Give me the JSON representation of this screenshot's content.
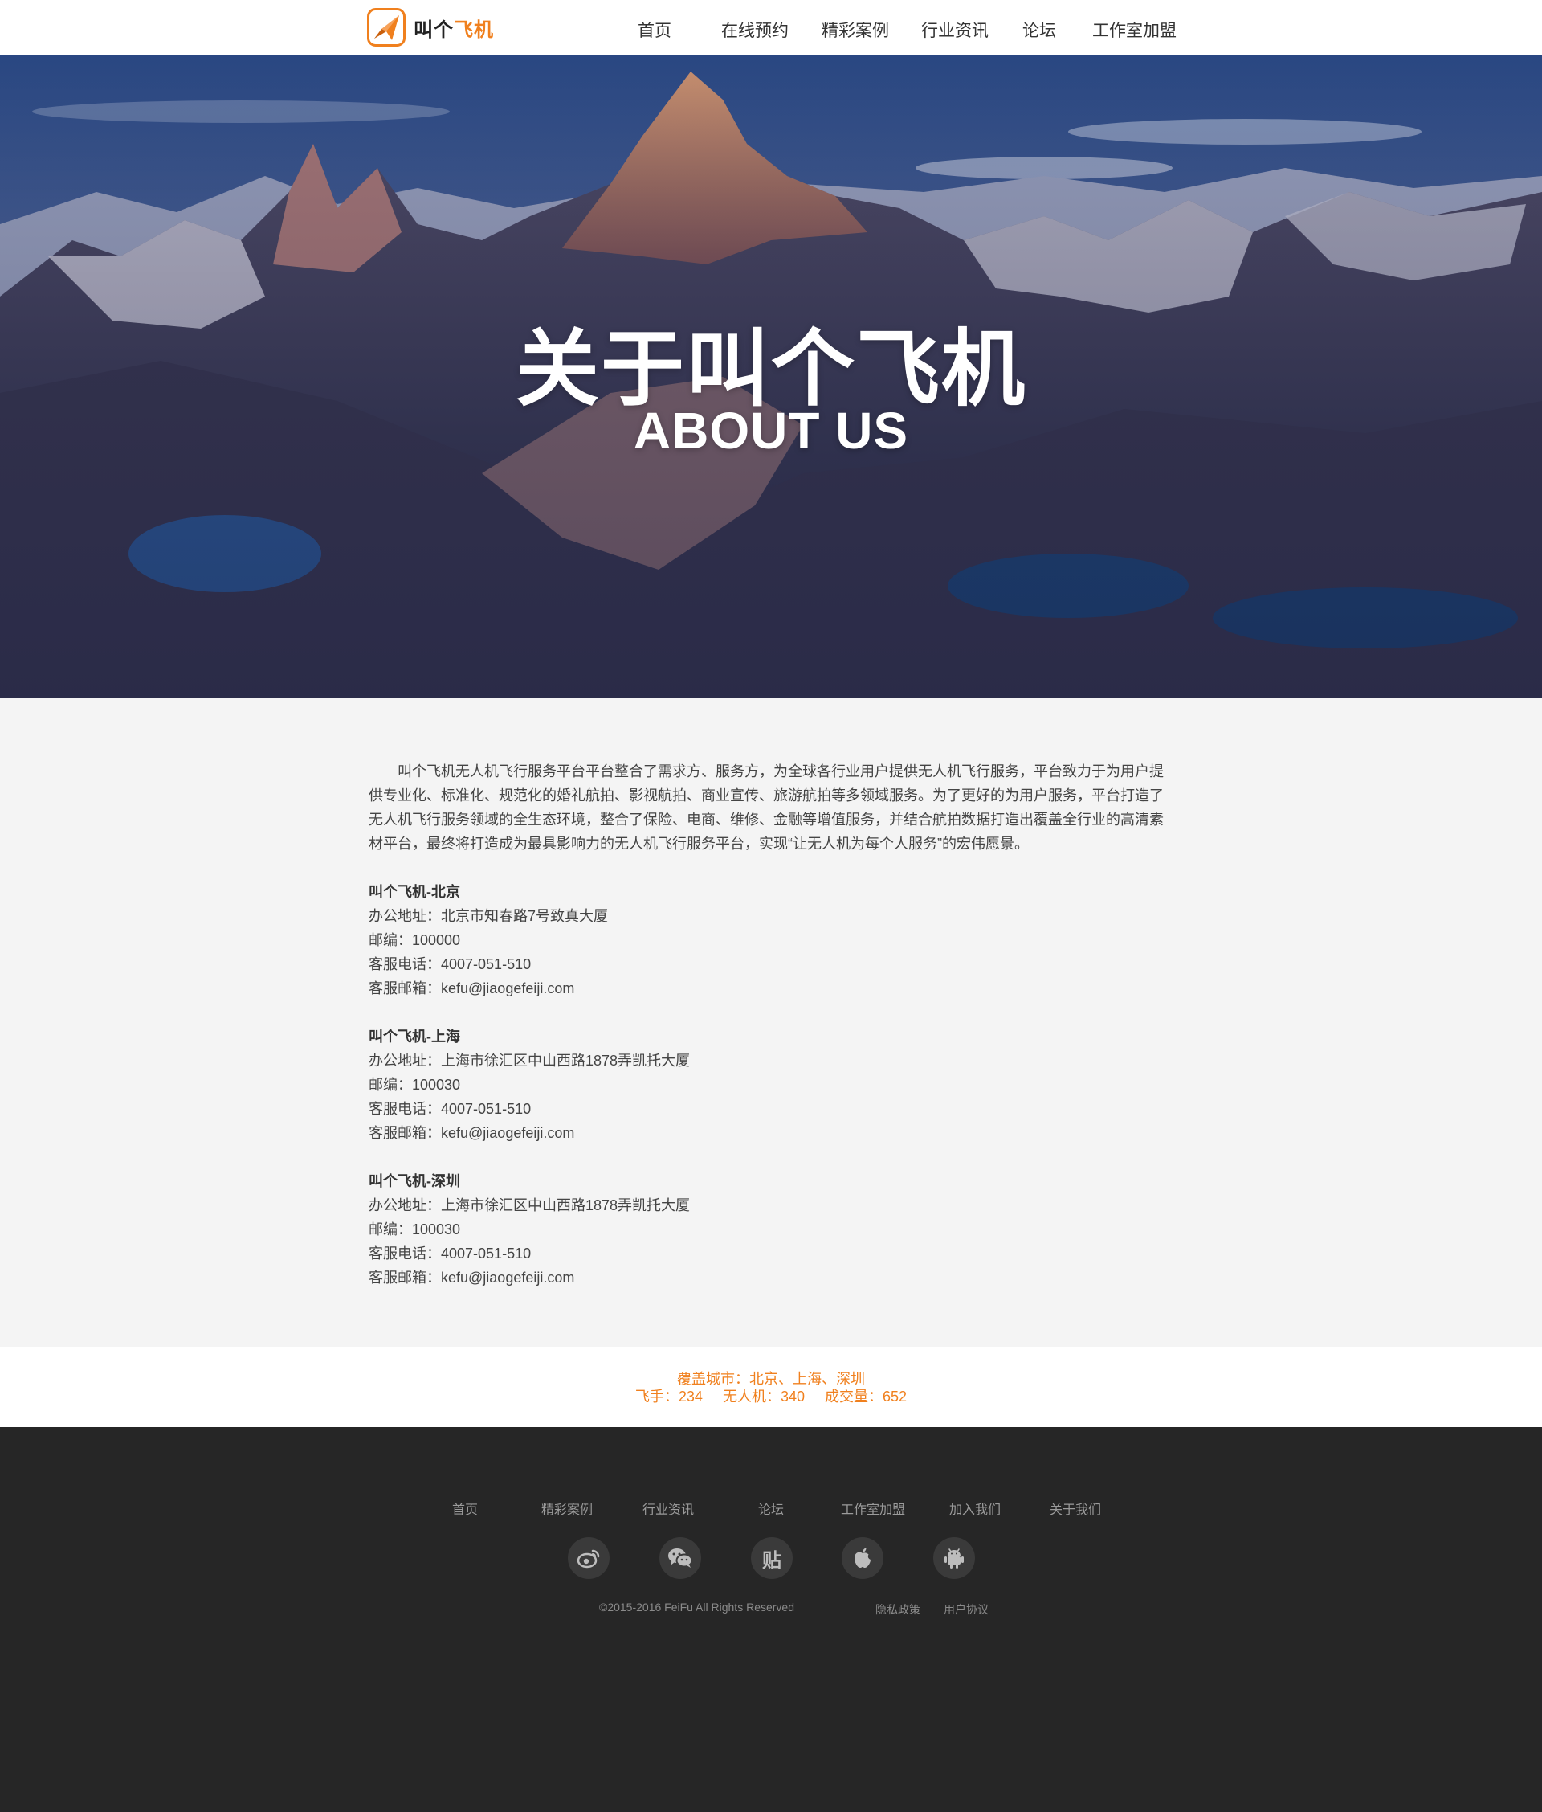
{
  "brand": {
    "name_plain": "叫个",
    "name_accent": "飞机",
    "accent_color": "#f0801e",
    "logo_icon": "paper-plane-logo-icon"
  },
  "nav": {
    "items": [
      {
        "label": "首页"
      },
      {
        "label": "在线预约"
      },
      {
        "label": "精彩案例"
      },
      {
        "label": "行业资讯"
      },
      {
        "label": "论坛"
      },
      {
        "label": "工作室加盟"
      }
    ]
  },
  "hero": {
    "title": "关于叫个飞机",
    "subtitle": "ABOUT US"
  },
  "about": {
    "intro": "叫个飞机无人机飞行服务平台平台整合了需求方、服务方，为全球各行业用户提供无人机飞行服务，平台致力于为用户提供专业化、标准化、规范化的婚礼航拍、影视航拍、商业宣传、旅游航拍等多领域服务。为了更好的为用户服务，平台打造了无人机飞行服务领域的全生态环境，整合了保险、电商、维修、金融等增值服务，并结合航拍数据打造出覆盖全行业的高清素材平台，最终将打造成为最具影响力的无人机飞行服务平台，实现“让无人机为每个人服务”的宏伟愿景。",
    "offices": [
      {
        "name": "叫个飞机-北京",
        "address": "办公地址：北京市知春路7号致真大厦",
        "postcode": "邮编：100000",
        "phone": "客服电话：4007-051-510",
        "email": "客服邮箱：kefu@jiaogefeiji.com"
      },
      {
        "name": "叫个飞机-上海",
        "address": "办公地址：上海市徐汇区中山西路1878弄凯托大厦",
        "postcode": "邮编：100030",
        "phone": "客服电话：4007-051-510",
        "email": "客服邮箱：kefu@jiaogefeiji.com"
      },
      {
        "name": "叫个飞机-深圳",
        "address": "办公地址：上海市徐汇区中山西路1878弄凯托大厦",
        "postcode": "邮编：100030",
        "phone": "客服电话：4007-051-510",
        "email": "客服邮箱：kefu@jiaogefeiji.com"
      }
    ]
  },
  "stats": {
    "cities": "覆盖城市：北京、上海、深圳",
    "pilots": "飞手：234",
    "drones": "无人机：340",
    "deals": "成交量：652"
  },
  "footer": {
    "nav": [
      {
        "label": "首页"
      },
      {
        "label": "精彩案例"
      },
      {
        "label": "行业资讯"
      },
      {
        "label": "论坛"
      },
      {
        "label": "工作室加盟"
      },
      {
        "label": "加入我们"
      },
      {
        "label": "关于我们"
      }
    ],
    "social": [
      {
        "icon": "weibo-icon"
      },
      {
        "icon": "wechat-icon"
      },
      {
        "icon": "tieba-icon",
        "glyph": "贴"
      },
      {
        "icon": "apple-icon"
      },
      {
        "icon": "android-icon"
      }
    ],
    "copyright": "©2015-2016 FeiFu All Rights Reserved",
    "privacy": "隐私政策",
    "terms": "用户协议"
  }
}
